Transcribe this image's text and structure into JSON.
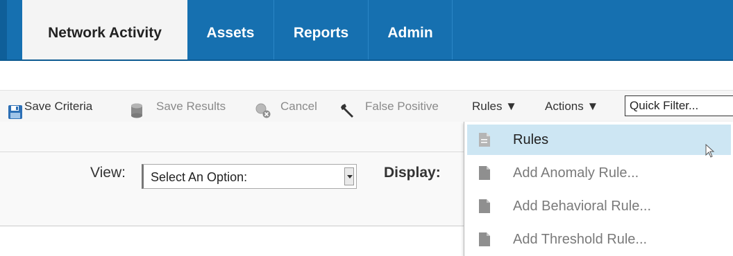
{
  "tabs": [
    {
      "label": "Network Activity",
      "active": true
    },
    {
      "label": "Assets",
      "active": false
    },
    {
      "label": "Reports",
      "active": false
    },
    {
      "label": "Admin",
      "active": false
    }
  ],
  "toolbar": {
    "save_criteria": {
      "label": "Save Criteria",
      "icon": "floppy-disk-icon"
    },
    "save_results": {
      "label": "Save Results",
      "icon": "database-icon"
    },
    "cancel": {
      "label": "Cancel",
      "icon": "magnifier-cancel-icon"
    },
    "false_positive": {
      "label": "False Positive",
      "icon": "wrench-icon"
    },
    "rules_menu": "Rules ▼",
    "actions_menu": "Actions ▼",
    "quick_filter": "Quick Filter..."
  },
  "view": {
    "label": "View:",
    "selected": "Select An Option:",
    "display_label": "Display:"
  },
  "rules_menu_items": [
    {
      "label": "Rules",
      "highlighted": true,
      "icon": "document-icon"
    },
    {
      "label": "Add Anomaly Rule...",
      "highlighted": false,
      "icon": "document-icon"
    },
    {
      "label": "Add Behavioral Rule...",
      "highlighted": false,
      "icon": "document-icon"
    },
    {
      "label": "Add Threshold Rule...",
      "highlighted": false,
      "icon": "document-icon"
    }
  ],
  "colors": {
    "tab_bar": "#1670b0",
    "active_tab": "#f4f4f4",
    "menu_highlight": "#cde6f3"
  }
}
